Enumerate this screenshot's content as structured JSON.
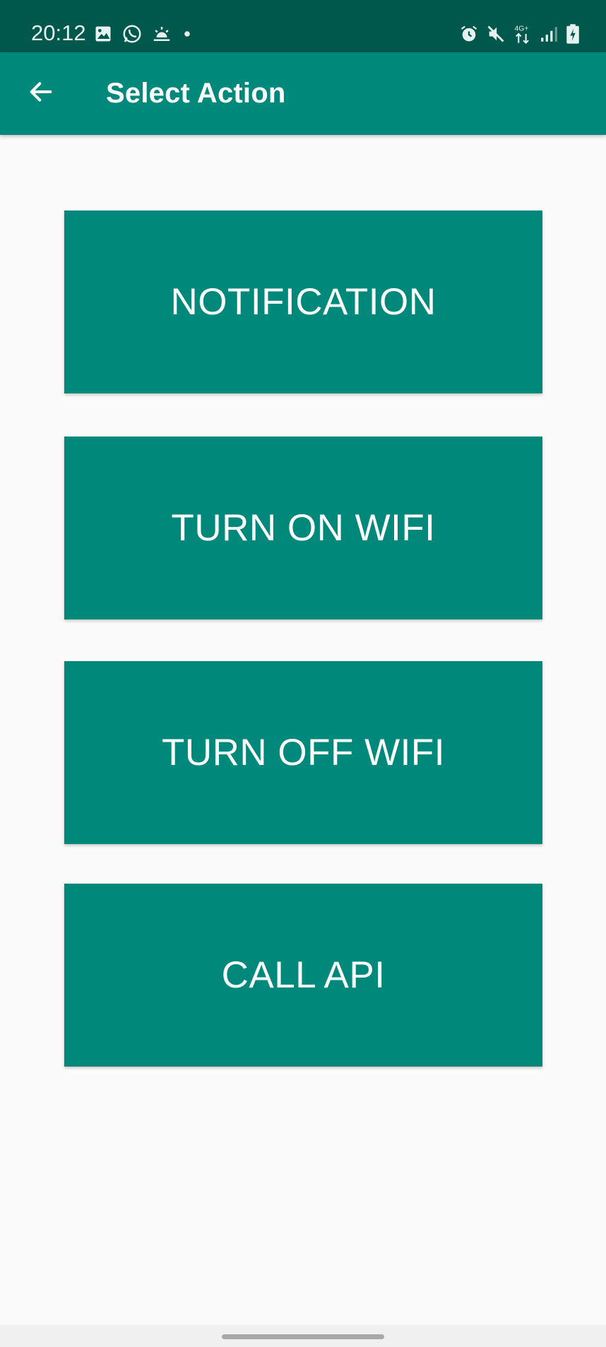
{
  "status_bar": {
    "time": "20:12",
    "left_icons": [
      "gallery-icon",
      "whatsapp-icon",
      "sunrise-icon",
      "dot-icon"
    ],
    "right_icons": [
      "alarm-icon",
      "mute-icon",
      "network-4g-icon",
      "signal-icon",
      "battery-charging-icon"
    ],
    "network_label": "4G+"
  },
  "app_bar": {
    "title": "Select Action",
    "back_icon": "arrow-left-icon"
  },
  "actions": [
    {
      "label": "NOTIFICATION"
    },
    {
      "label": "TURN ON WIFI"
    },
    {
      "label": "TURN OFF WIFI"
    },
    {
      "label": "CALL API"
    }
  ],
  "colors": {
    "primary": "#00897b",
    "primary_dark": "#00574b",
    "background": "#fafafa",
    "button_text": "#ffffff"
  }
}
